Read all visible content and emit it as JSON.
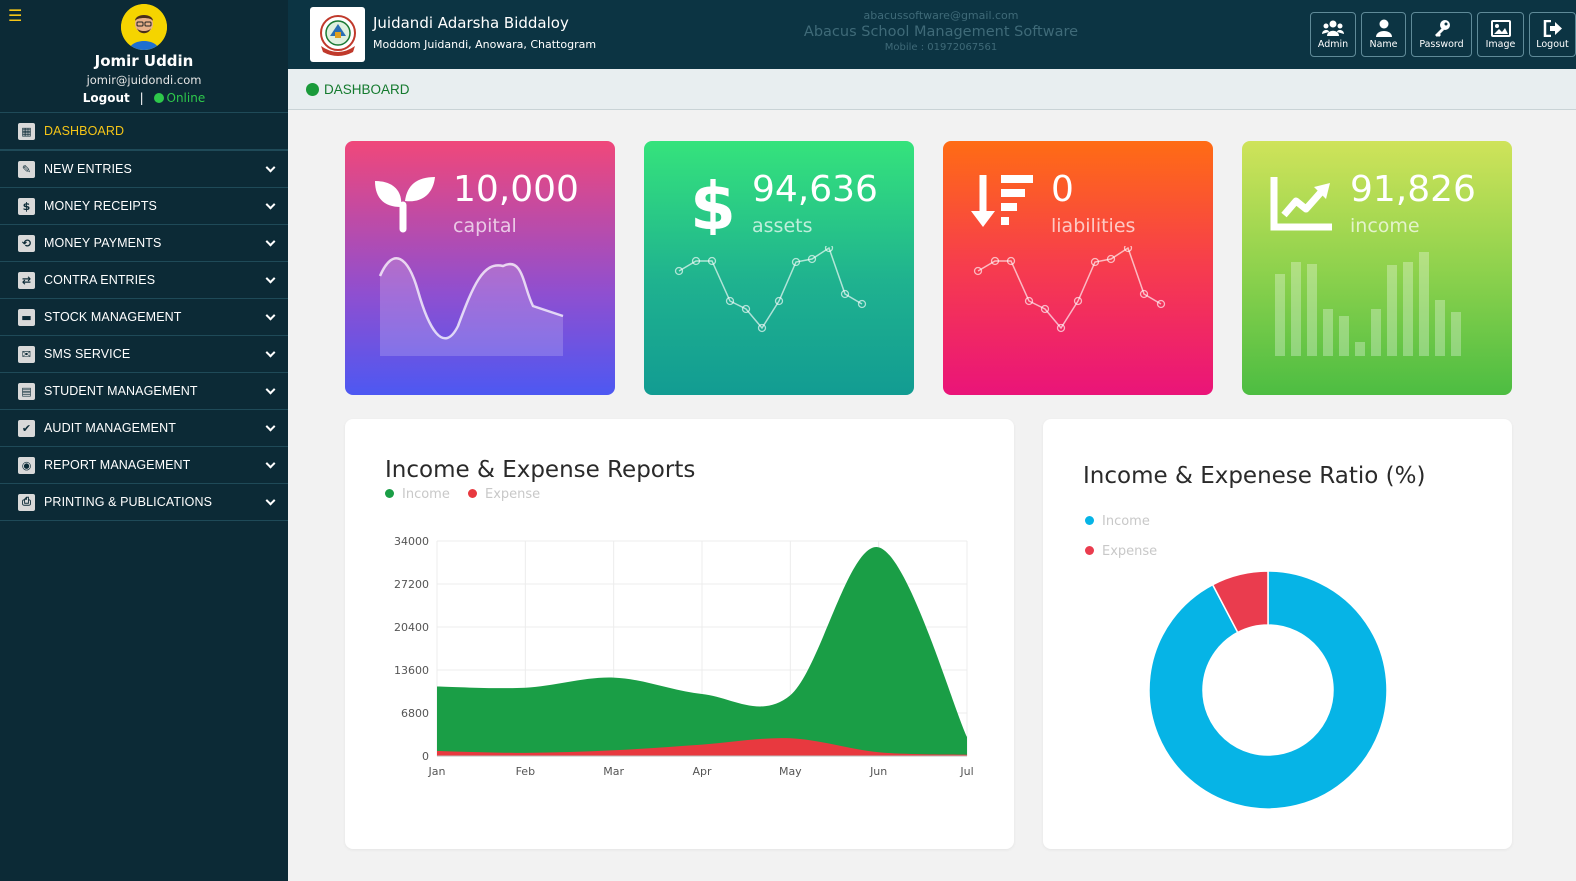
{
  "sidebar": {
    "menu_icon": "hamburger-icon",
    "user": {
      "name": "Jomir Uddin",
      "email": "jomir@juidondi.com",
      "logout": "Logout",
      "separator": "|",
      "status": "Online"
    },
    "items": [
      {
        "label": "DASHBOARD",
        "icon": "dashboard-icon",
        "glyph": "▦",
        "active": true
      },
      {
        "label": "NEW ENTRIES",
        "icon": "edit-icon",
        "glyph": "✎"
      },
      {
        "label": "MONEY RECEIPTS",
        "icon": "dollar-icon",
        "glyph": "$"
      },
      {
        "label": "MONEY PAYMENTS",
        "icon": "payment-icon",
        "glyph": "⟲"
      },
      {
        "label": "CONTRA ENTRIES",
        "icon": "exchange-icon",
        "glyph": "⇄"
      },
      {
        "label": "STOCK MANAGEMENT",
        "icon": "stock-icon",
        "glyph": "▬"
      },
      {
        "label": "SMS SERVICE",
        "icon": "envelope-icon",
        "glyph": "✉"
      },
      {
        "label": "STUDENT MANAGEMENT",
        "icon": "student-icon",
        "glyph": "▤"
      },
      {
        "label": "AUDIT MANAGEMENT",
        "icon": "check-icon",
        "glyph": "✔"
      },
      {
        "label": "REPORT MANAGEMENT",
        "icon": "eye-icon",
        "glyph": "◉"
      },
      {
        "label": "PRINTING & PUBLICATIONS",
        "icon": "print-icon",
        "glyph": "⎙"
      }
    ]
  },
  "header": {
    "school_name": "Juidandi Adarsha Biddaloy",
    "school_address": "Moddom Juidandi, Anowara, Chattogram",
    "software_email": "abacussoftware@gmail.com",
    "software_title": "Abacus School Management Software",
    "software_mobile": "Mobile : 01972067561",
    "buttons": [
      {
        "label": "Admin",
        "icon": "users-icon",
        "glyph": "👥"
      },
      {
        "label": "Name",
        "icon": "user-icon",
        "glyph": "👤"
      },
      {
        "label": "Password",
        "icon": "key-icon",
        "glyph": "🔑"
      },
      {
        "label": "Image",
        "icon": "image-icon",
        "glyph": "🖼"
      },
      {
        "label": "Logout",
        "icon": "logout-icon",
        "glyph": "⇥"
      }
    ]
  },
  "breadcrumb": {
    "label": "DASHBOARD"
  },
  "cards": [
    {
      "value": "10,000",
      "label": "capital",
      "icon": "sprout-icon"
    },
    {
      "value": "94,636",
      "label": "assets",
      "icon": "dollar-sign-icon"
    },
    {
      "value": "0",
      "label": "liabilities",
      "icon": "sort-amount-down-icon"
    },
    {
      "value": "91,826",
      "label": "income",
      "icon": "area-chart-icon"
    }
  ],
  "chart_data": [
    {
      "type": "area",
      "title": "Income & Expense Reports",
      "categories": [
        "Jan",
        "Feb",
        "Mar",
        "Apr",
        "May",
        "Jun",
        "Jul"
      ],
      "y_ticks": [
        "34000",
        "27200",
        "20400",
        "13600",
        "6800",
        "0"
      ],
      "ylim": [
        0,
        34000
      ],
      "series": [
        {
          "name": "Income",
          "color": "#1a9e46",
          "values": [
            11000,
            10800,
            12400,
            9800,
            9600,
            33000,
            3000
          ]
        },
        {
          "name": "Expense",
          "color": "#e8393f",
          "values": [
            800,
            500,
            900,
            1800,
            2800,
            600,
            200
          ]
        }
      ],
      "legend": "top-left"
    },
    {
      "type": "pie",
      "title": "Income & Expenese Ratio (%)",
      "series": [
        {
          "name": "Income",
          "color": "#06b4e6",
          "value": 92.3
        },
        {
          "name": "Expense",
          "color": "#ea3c4e",
          "value": 7.7
        }
      ],
      "legend": "top-left"
    }
  ]
}
